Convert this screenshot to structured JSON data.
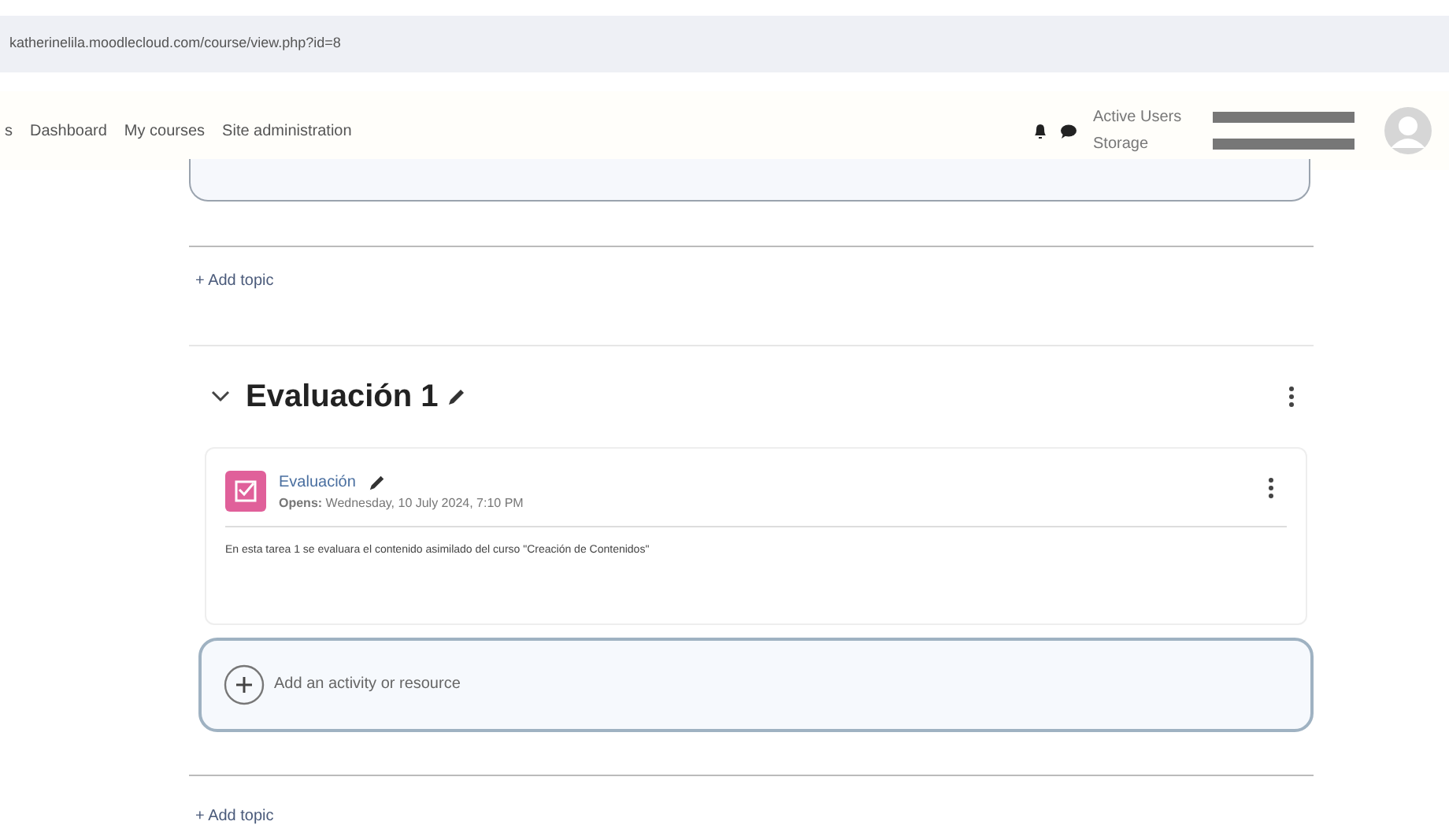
{
  "address_bar": {
    "url": "katherinelila.moodlecloud.com/course/view.php?id=8"
  },
  "nav": {
    "items": [
      "s",
      "Dashboard",
      "My courses",
      "Site administration"
    ]
  },
  "usage": {
    "labels": [
      "Active Users",
      "Storage"
    ]
  },
  "add_topic_top": "+ Add topic",
  "section": {
    "title": "Evaluación 1",
    "expanded": true,
    "activity": {
      "name": "Evaluación",
      "dates": "**Opens:** Wednesday, 10 July 2024, 7:10 PM",
      "description": "En esta tarea 1 se evaluara el contenido asimilado del curso \"Creación de Contenidos\""
    },
    "add_activity": "Add an activity or resource"
  },
  "add_topic_bottom": "+ Add topic"
}
